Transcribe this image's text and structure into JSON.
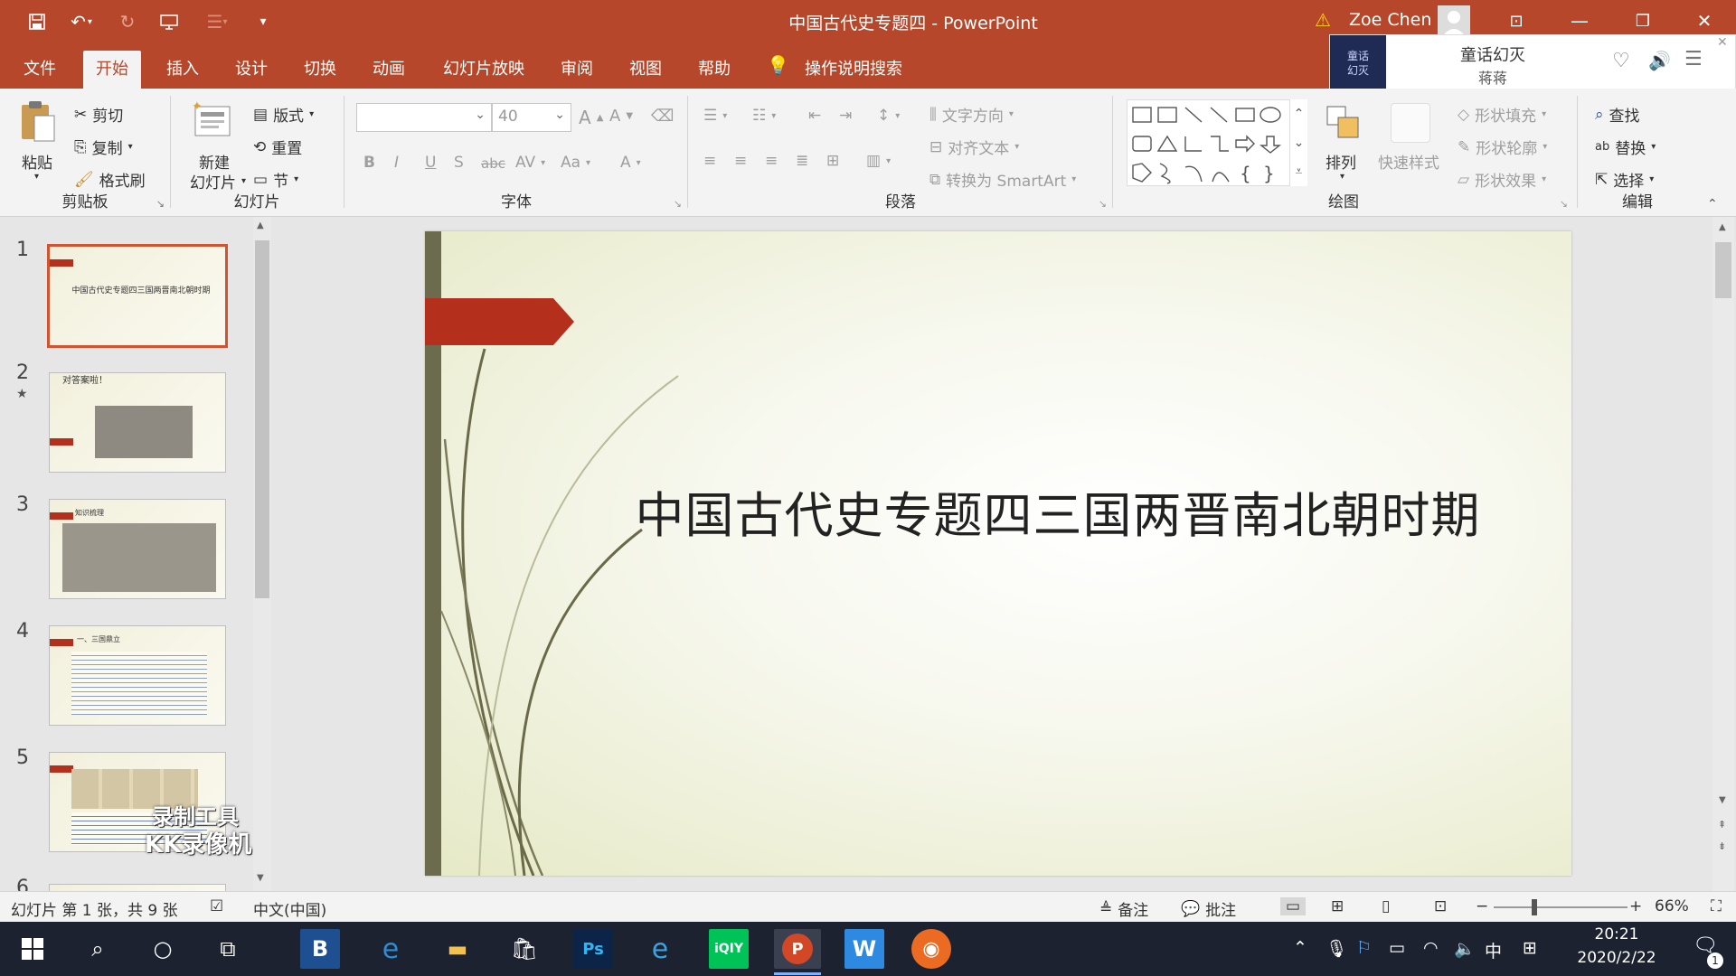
{
  "window": {
    "title": "中国古代史专题四 - PowerPoint",
    "user": "Zoe Chen",
    "warning_icon": "warning-icon"
  },
  "tabs": [
    "文件",
    "开始",
    "插入",
    "设计",
    "切换",
    "动画",
    "幻灯片放映",
    "审阅",
    "视图",
    "帮助"
  ],
  "active_tab": "开始",
  "tell_me": "操作说明搜索",
  "music": {
    "song": "童话幻灭",
    "artist": "蒋蒋",
    "cover_text": "童话\n幻灭"
  },
  "ribbon": {
    "clipboard": {
      "label": "剪贴板",
      "paste": "粘贴",
      "cut": "剪切",
      "copy": "复制",
      "format_painter": "格式刷"
    },
    "slides": {
      "label": "幻灯片",
      "new_slide": "新建",
      "new_slide2": "幻灯片",
      "layout": "版式",
      "reset": "重置",
      "section": "节"
    },
    "font": {
      "label": "字体",
      "font_name": "",
      "font_size": "40",
      "bold": "B",
      "italic": "I",
      "underline": "U",
      "shadow": "S",
      "strike": "abc",
      "spacing": "AV",
      "case": "Aa",
      "color": "A"
    },
    "paragraph": {
      "label": "段落",
      "text_direction": "文字方向",
      "align_text": "对齐文本",
      "smartart": "转换为 SmartArt"
    },
    "drawing": {
      "label": "绘图",
      "arrange": "排列",
      "quick_styles": "快速样式",
      "fill": "形状填充",
      "outline": "形状轮廓",
      "effects": "形状效果"
    },
    "editing": {
      "label": "编辑",
      "find": "查找",
      "replace": "替换",
      "select": "选择"
    }
  },
  "thumbnails": [
    {
      "num": "1",
      "text": "中国古代史专题四三国两晋南北朝时期",
      "star": ""
    },
    {
      "num": "2",
      "text": "对答案啦！",
      "star": "★"
    },
    {
      "num": "3",
      "text": "知识梳理",
      "star": ""
    },
    {
      "num": "4",
      "text": "一、三国鼎立",
      "star": ""
    },
    {
      "num": "5",
      "text": "",
      "star": ""
    },
    {
      "num": "6",
      "text": "",
      "star": ""
    }
  ],
  "watermark": {
    "line1": "录制工具",
    "line2": "KK录像机"
  },
  "slide": {
    "title": "中国古代史专题四三国两晋南北朝时期"
  },
  "status": {
    "slide_info": "幻灯片 第 1 张，共 9 张",
    "language": "中文(中国)",
    "notes": "备注",
    "comments": "批注",
    "zoom": "66%"
  },
  "taskbar": {
    "time": "20:21",
    "date": "2020/2/22",
    "ime": "中",
    "notif_count": "1"
  },
  "colors": {
    "accent": "#b7472a",
    "flag": "#b5301c",
    "taskbar": "#1c2230"
  }
}
